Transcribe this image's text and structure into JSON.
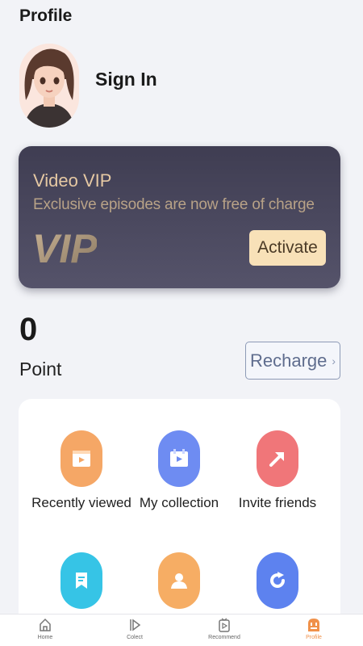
{
  "header": {
    "title": "Profile"
  },
  "user": {
    "sign_in_label": "Sign In"
  },
  "vip": {
    "title": "Video VIP",
    "subtitle": "Exclusive episodes are now free of charge",
    "logo_text": "VIP",
    "activate_label": "Activate"
  },
  "points": {
    "value": "0",
    "label": "Point",
    "recharge_label": "Recharge"
  },
  "features": [
    {
      "label": "Recently viewed",
      "icon": "film-icon",
      "color": "#f5a766"
    },
    {
      "label": "My collection",
      "icon": "collection-icon",
      "color": "#6e8cf2"
    },
    {
      "label": "Invite friends",
      "icon": "share-arrow-icon",
      "color": "#f07679"
    },
    {
      "label": "",
      "icon": "bookmark-icon",
      "color": "#36c4e6"
    },
    {
      "label": "",
      "icon": "person-icon",
      "color": "#f6ad64"
    },
    {
      "label": "",
      "icon": "refresh-icon",
      "color": "#5d82ef"
    }
  ],
  "tabbar": {
    "items": [
      {
        "label": "Home",
        "icon": "home-icon"
      },
      {
        "label": "Colect",
        "icon": "play-icon"
      },
      {
        "label": "Recommend",
        "icon": "recommend-icon"
      },
      {
        "label": "Profile",
        "icon": "profile-icon",
        "active": true
      }
    ],
    "active_color": "#f0914a"
  }
}
